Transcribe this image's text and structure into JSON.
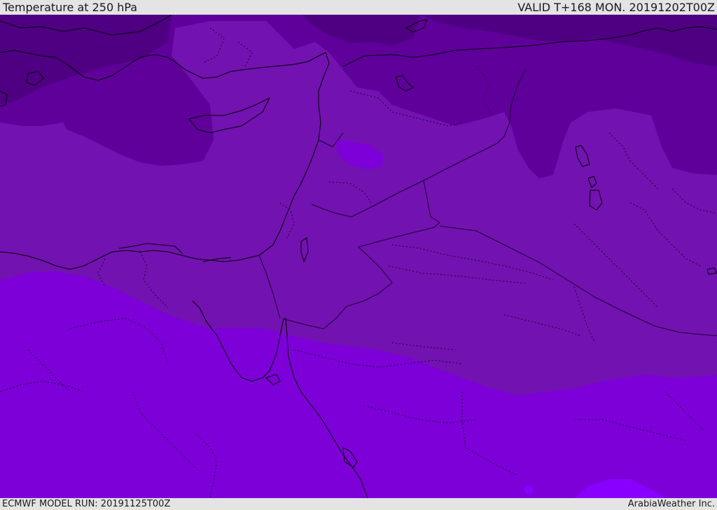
{
  "header": {
    "title": "Temperature at 250 hPa",
    "valid": "VALID T+168 MON. 20191202T00Z"
  },
  "footer": {
    "model_run": "ECMWF MODEL RUN: 20191125T00Z",
    "credit": "ArabiaWeather Inc."
  },
  "colors": {
    "band_coldest": "#4f0082",
    "band_cold": "#5f009b",
    "band_mid": "#7212b0",
    "band_warm": "#7d00d9",
    "band_warmest": "#8a00ff",
    "coastline": "#000000",
    "border": "#1c0030"
  }
}
